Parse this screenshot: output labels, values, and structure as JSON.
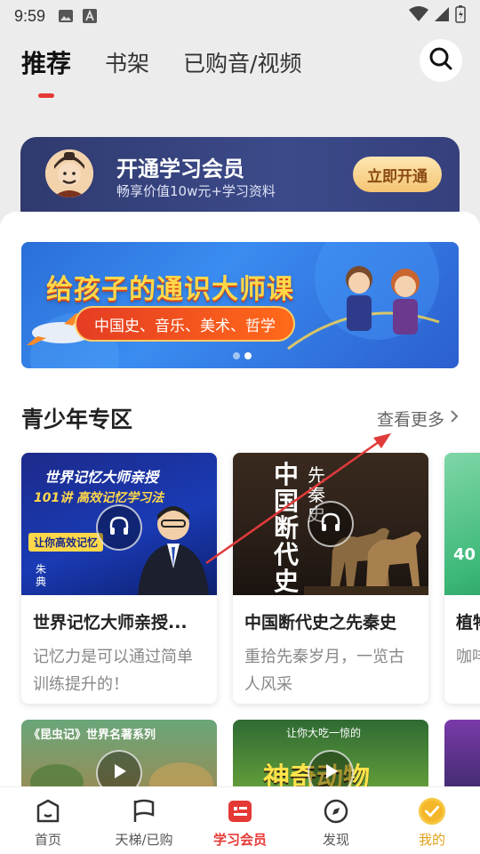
{
  "status_bar": {
    "time": "9:59"
  },
  "top_tabs": [
    {
      "label": "推荐"
    },
    {
      "label": "书架"
    },
    {
      "label": "已购音/视频"
    }
  ],
  "vip_banner": {
    "title": "开通学习会员",
    "subtitle": "畅享价值10w元+学习资料",
    "button": "立即开通"
  },
  "hero": {
    "title": "给孩子的通识大师课",
    "pill": "中国史、音乐、美术、哲学"
  },
  "section": {
    "title": "青少年专区",
    "see_more": "查看更多"
  },
  "cards": [
    {
      "title": "世界记忆大师亲授...",
      "desc": "记忆力是可以通过简单训练提升的！",
      "cover_title": "世界记忆大师亲授",
      "cover_sub": "101讲 高效记忆学习法",
      "cover_tag": "让你高效记忆",
      "cover_side": "朱典"
    },
    {
      "title": "中国断代史之先秦史",
      "desc": "重拾先秦岁月，一览古人风采",
      "cover_title": "中国断代史",
      "cover_sub": "先秦史"
    },
    {
      "title": "植物",
      "desc": "咖啡的",
      "cover_title": "40"
    }
  ],
  "cards_row2": [
    {
      "cover_title": "《昆虫记》世界名著系列"
    },
    {
      "cover_title": "神奇动物",
      "cover_sub": "让你大吃一惊的"
    },
    {
      "cover_title": ""
    }
  ],
  "bottom_nav": [
    {
      "label": "首页"
    },
    {
      "label": "天梯/已购"
    },
    {
      "label": "学习会员"
    },
    {
      "label": "发现"
    },
    {
      "label": "我的"
    }
  ],
  "colors": {
    "accent": "#e53935",
    "vip_gold": "#f5c574",
    "banner_navy": "#2f3a6e"
  }
}
